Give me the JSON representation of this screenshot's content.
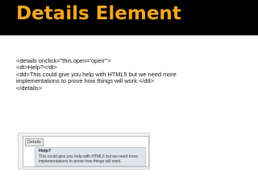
{
  "slide": {
    "title": "Details Element",
    "code_lines": [
      "<details onclick=\"this.open='open'\">",
      "<dt>Help?</dt>",
      "<dd>This could give you help with HTML5 but we need more",
      "implementations to prove how things will work.</dd>",
      "</details>"
    ]
  },
  "demo": {
    "tab_label": "Details",
    "summary": "Help?",
    "body_lines": [
      "This could give you help with HTML5 but we need more",
      "implementations to prove how things will work."
    ]
  },
  "colors": {
    "title_bar": "#000000",
    "title_text": "#f5a623"
  }
}
